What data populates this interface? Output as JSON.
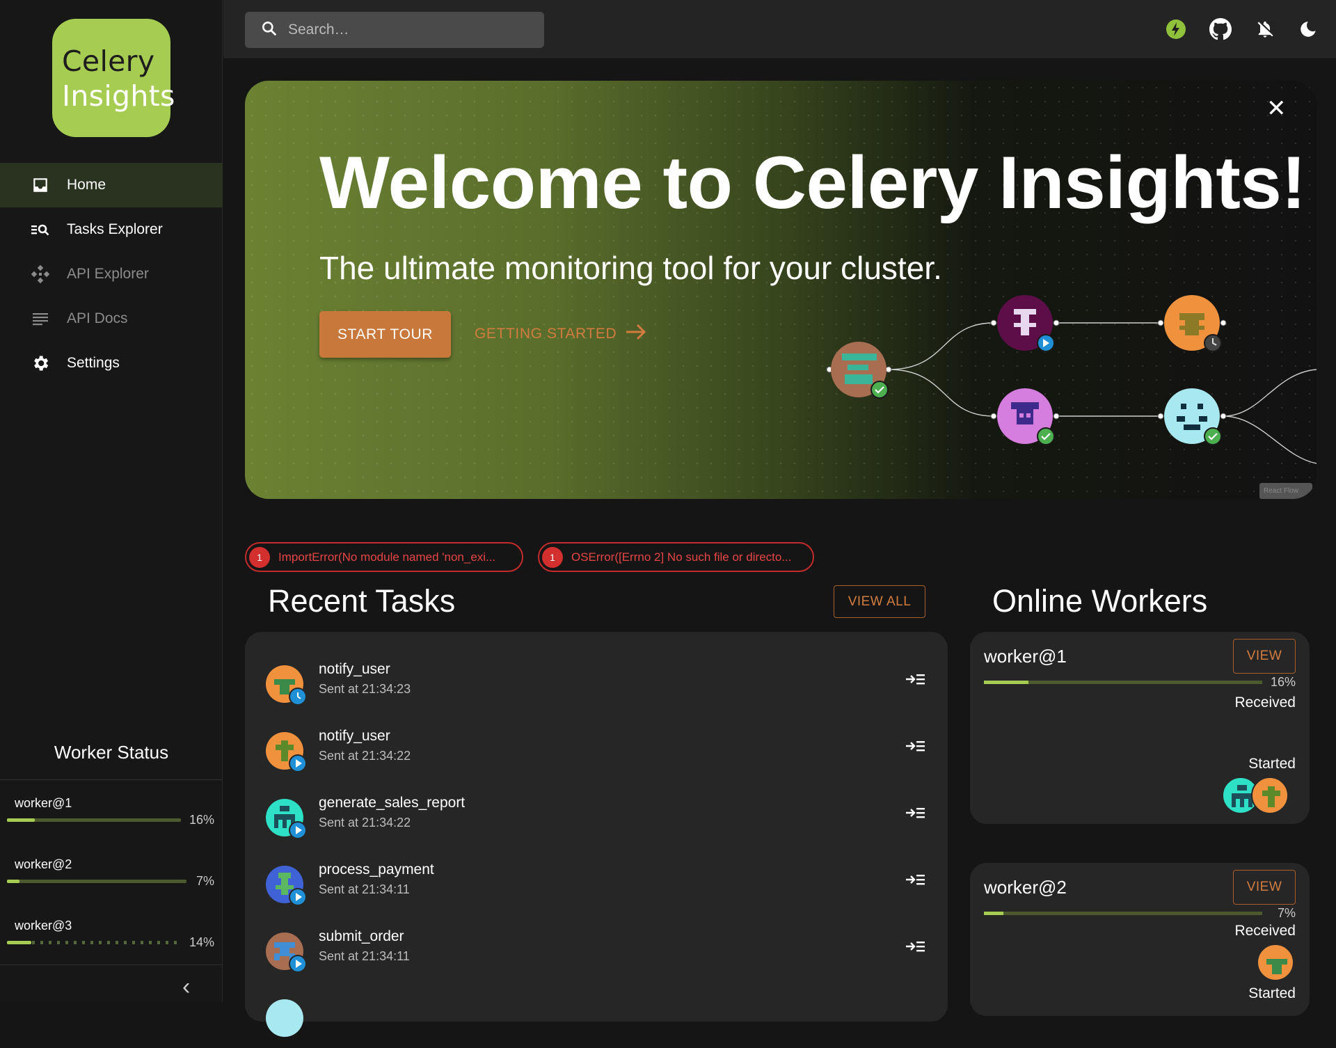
{
  "app": {
    "logo_line1": "Celery",
    "logo_line2": "Insights",
    "accent_color": "#a6cc52",
    "cta_color": "#c9783b"
  },
  "sidebar": {
    "items": [
      {
        "label": "Home",
        "icon": "inbox-icon",
        "active": true
      },
      {
        "label": "Tasks Explorer",
        "icon": "list-search-icon"
      },
      {
        "label": "API Explorer",
        "icon": "api-icon"
      },
      {
        "label": "API Docs",
        "icon": "notes-icon"
      },
      {
        "label": "Settings",
        "icon": "gear-icon"
      }
    ],
    "worker_status_title": "Worker Status",
    "workers": [
      {
        "name": "worker@1",
        "percent": "16%",
        "fill": 0.16
      },
      {
        "name": "worker@2",
        "percent": "7%",
        "fill": 0.07
      },
      {
        "name": "worker@3",
        "percent": "14%",
        "fill": 0.14
      }
    ],
    "collapse_glyph": "‹"
  },
  "topbar": {
    "search_placeholder": "Search…",
    "icons": [
      "bolt-status-icon",
      "github-icon",
      "notifications-off-icon",
      "dark-mode-icon"
    ]
  },
  "hero": {
    "title": "Welcome to Celery Insights!",
    "subtitle": "The ultimate monitoring tool for your cluster.",
    "start_tour": "START TOUR",
    "getting_started": "GETTING STARTED",
    "close_glyph": "✕",
    "attribution": "React Flow"
  },
  "errors": [
    {
      "count": "1",
      "text": "ImportError(No module named 'non_exi..."
    },
    {
      "count": "1",
      "text": "OSError([Errno 2] No such file or directo..."
    }
  ],
  "recent_tasks": {
    "title": "Recent Tasks",
    "view_all": "VIEW ALL",
    "items": [
      {
        "name": "notify_user",
        "time": "Sent at 21:34:23",
        "avatar": "orange",
        "status": "clock"
      },
      {
        "name": "notify_user",
        "time": "Sent at 21:34:22",
        "avatar": "orange",
        "status": "play"
      },
      {
        "name": "generate_sales_report",
        "time": "Sent at 21:34:22",
        "avatar": "teal",
        "status": "play"
      },
      {
        "name": "process_payment",
        "time": "Sent at 21:34:11",
        "avatar": "blue",
        "status": "play"
      },
      {
        "name": "submit_order",
        "time": "Sent at 21:34:11",
        "avatar": "brown",
        "status": "play"
      }
    ]
  },
  "online_workers": {
    "title": "Online Workers",
    "workers": [
      {
        "name": "worker@1",
        "view": "VIEW",
        "percent": "16%",
        "fill": 0.16,
        "received": "Received",
        "started": "Started"
      },
      {
        "name": "worker@2",
        "view": "VIEW",
        "percent": "7%",
        "fill": 0.07,
        "received": "Received",
        "started": "Started"
      }
    ]
  }
}
